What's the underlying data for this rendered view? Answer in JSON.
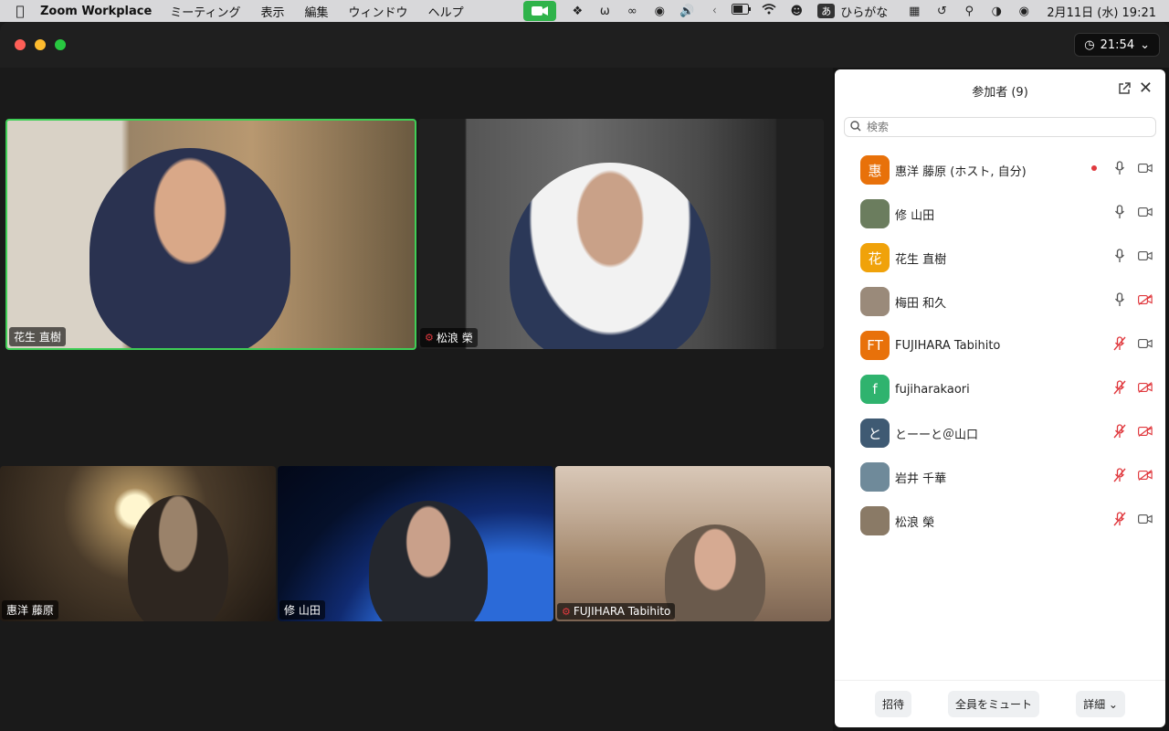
{
  "menubar": {
    "app_name": "Zoom Workplace",
    "menus": [
      "ミーティング",
      "表示",
      "編集",
      "ウィンドウ",
      "ヘルプ"
    ],
    "ime_box": "あ",
    "ime_label": "ひらがな",
    "clock": "2月11日 (水)  19:21"
  },
  "window": {
    "timer": "21:54"
  },
  "tiles": [
    {
      "name": "花生 直樹",
      "muted": false,
      "active": true
    },
    {
      "name": "松浪 榮",
      "muted": true,
      "active": false
    },
    {
      "name": "惠洋 藤原",
      "muted": false,
      "active": false
    },
    {
      "name": "修 山田",
      "muted": false,
      "active": false
    },
    {
      "name": "FUJIHARA Tabihito",
      "muted": true,
      "active": false
    }
  ],
  "panel": {
    "title": "参加者 (9)",
    "search_placeholder": "検索",
    "participants": [
      {
        "avatar": "惠",
        "color": "#e8710a",
        "name": "惠洋 藤原 (ホスト, 自分)",
        "mic": "on",
        "video": "on",
        "recording": true
      },
      {
        "avatar": "",
        "color": "#6b7d5e",
        "name": "修 山田",
        "mic": "on",
        "video": "on",
        "recording": false
      },
      {
        "avatar": "花",
        "color": "#f0a20a",
        "name": "花生 直樹",
        "mic": "on",
        "video": "on",
        "recording": false
      },
      {
        "avatar": "",
        "color": "#9a8a7a",
        "name": "梅田 和久",
        "mic": "on",
        "video": "off",
        "recording": false
      },
      {
        "avatar": "FT",
        "color": "#e8710a",
        "name": "FUJIHARA Tabihito",
        "mic": "off",
        "video": "on",
        "recording": false
      },
      {
        "avatar": "f",
        "color": "#2fb36e",
        "name": "fujiharakaori",
        "mic": "off",
        "video": "off",
        "recording": false
      },
      {
        "avatar": "と",
        "color": "#3f5a73",
        "name": "とーーと＠山口",
        "mic": "off",
        "video": "off",
        "recording": false
      },
      {
        "avatar": "",
        "color": "#6f8a9a",
        "name": "岩井 千華",
        "mic": "off",
        "video": "off",
        "recording": false
      },
      {
        "avatar": "",
        "color": "#8a7a66",
        "name": "松浪 榮",
        "mic": "off",
        "video": "on",
        "recording": false
      }
    ],
    "footer": {
      "invite": "招待",
      "mute_all": "全員をミュート",
      "more": "詳細"
    }
  }
}
